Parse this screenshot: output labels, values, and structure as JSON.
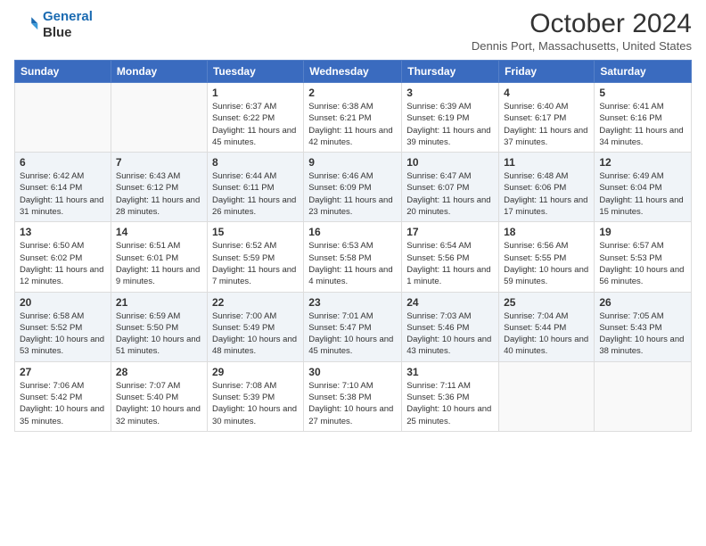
{
  "header": {
    "logo_line1": "General",
    "logo_line2": "Blue",
    "month": "October 2024",
    "location": "Dennis Port, Massachusetts, United States"
  },
  "weekdays": [
    "Sunday",
    "Monday",
    "Tuesday",
    "Wednesday",
    "Thursday",
    "Friday",
    "Saturday"
  ],
  "weeks": [
    [
      {
        "day": "",
        "sunrise": "",
        "sunset": "",
        "daylight": ""
      },
      {
        "day": "",
        "sunrise": "",
        "sunset": "",
        "daylight": ""
      },
      {
        "day": "1",
        "sunrise": "Sunrise: 6:37 AM",
        "sunset": "Sunset: 6:22 PM",
        "daylight": "Daylight: 11 hours and 45 minutes."
      },
      {
        "day": "2",
        "sunrise": "Sunrise: 6:38 AM",
        "sunset": "Sunset: 6:21 PM",
        "daylight": "Daylight: 11 hours and 42 minutes."
      },
      {
        "day": "3",
        "sunrise": "Sunrise: 6:39 AM",
        "sunset": "Sunset: 6:19 PM",
        "daylight": "Daylight: 11 hours and 39 minutes."
      },
      {
        "day": "4",
        "sunrise": "Sunrise: 6:40 AM",
        "sunset": "Sunset: 6:17 PM",
        "daylight": "Daylight: 11 hours and 37 minutes."
      },
      {
        "day": "5",
        "sunrise": "Sunrise: 6:41 AM",
        "sunset": "Sunset: 6:16 PM",
        "daylight": "Daylight: 11 hours and 34 minutes."
      }
    ],
    [
      {
        "day": "6",
        "sunrise": "Sunrise: 6:42 AM",
        "sunset": "Sunset: 6:14 PM",
        "daylight": "Daylight: 11 hours and 31 minutes."
      },
      {
        "day": "7",
        "sunrise": "Sunrise: 6:43 AM",
        "sunset": "Sunset: 6:12 PM",
        "daylight": "Daylight: 11 hours and 28 minutes."
      },
      {
        "day": "8",
        "sunrise": "Sunrise: 6:44 AM",
        "sunset": "Sunset: 6:11 PM",
        "daylight": "Daylight: 11 hours and 26 minutes."
      },
      {
        "day": "9",
        "sunrise": "Sunrise: 6:46 AM",
        "sunset": "Sunset: 6:09 PM",
        "daylight": "Daylight: 11 hours and 23 minutes."
      },
      {
        "day": "10",
        "sunrise": "Sunrise: 6:47 AM",
        "sunset": "Sunset: 6:07 PM",
        "daylight": "Daylight: 11 hours and 20 minutes."
      },
      {
        "day": "11",
        "sunrise": "Sunrise: 6:48 AM",
        "sunset": "Sunset: 6:06 PM",
        "daylight": "Daylight: 11 hours and 17 minutes."
      },
      {
        "day": "12",
        "sunrise": "Sunrise: 6:49 AM",
        "sunset": "Sunset: 6:04 PM",
        "daylight": "Daylight: 11 hours and 15 minutes."
      }
    ],
    [
      {
        "day": "13",
        "sunrise": "Sunrise: 6:50 AM",
        "sunset": "Sunset: 6:02 PM",
        "daylight": "Daylight: 11 hours and 12 minutes."
      },
      {
        "day": "14",
        "sunrise": "Sunrise: 6:51 AM",
        "sunset": "Sunset: 6:01 PM",
        "daylight": "Daylight: 11 hours and 9 minutes."
      },
      {
        "day": "15",
        "sunrise": "Sunrise: 6:52 AM",
        "sunset": "Sunset: 5:59 PM",
        "daylight": "Daylight: 11 hours and 7 minutes."
      },
      {
        "day": "16",
        "sunrise": "Sunrise: 6:53 AM",
        "sunset": "Sunset: 5:58 PM",
        "daylight": "Daylight: 11 hours and 4 minutes."
      },
      {
        "day": "17",
        "sunrise": "Sunrise: 6:54 AM",
        "sunset": "Sunset: 5:56 PM",
        "daylight": "Daylight: 11 hours and 1 minute."
      },
      {
        "day": "18",
        "sunrise": "Sunrise: 6:56 AM",
        "sunset": "Sunset: 5:55 PM",
        "daylight": "Daylight: 10 hours and 59 minutes."
      },
      {
        "day": "19",
        "sunrise": "Sunrise: 6:57 AM",
        "sunset": "Sunset: 5:53 PM",
        "daylight": "Daylight: 10 hours and 56 minutes."
      }
    ],
    [
      {
        "day": "20",
        "sunrise": "Sunrise: 6:58 AM",
        "sunset": "Sunset: 5:52 PM",
        "daylight": "Daylight: 10 hours and 53 minutes."
      },
      {
        "day": "21",
        "sunrise": "Sunrise: 6:59 AM",
        "sunset": "Sunset: 5:50 PM",
        "daylight": "Daylight: 10 hours and 51 minutes."
      },
      {
        "day": "22",
        "sunrise": "Sunrise: 7:00 AM",
        "sunset": "Sunset: 5:49 PM",
        "daylight": "Daylight: 10 hours and 48 minutes."
      },
      {
        "day": "23",
        "sunrise": "Sunrise: 7:01 AM",
        "sunset": "Sunset: 5:47 PM",
        "daylight": "Daylight: 10 hours and 45 minutes."
      },
      {
        "day": "24",
        "sunrise": "Sunrise: 7:03 AM",
        "sunset": "Sunset: 5:46 PM",
        "daylight": "Daylight: 10 hours and 43 minutes."
      },
      {
        "day": "25",
        "sunrise": "Sunrise: 7:04 AM",
        "sunset": "Sunset: 5:44 PM",
        "daylight": "Daylight: 10 hours and 40 minutes."
      },
      {
        "day": "26",
        "sunrise": "Sunrise: 7:05 AM",
        "sunset": "Sunset: 5:43 PM",
        "daylight": "Daylight: 10 hours and 38 minutes."
      }
    ],
    [
      {
        "day": "27",
        "sunrise": "Sunrise: 7:06 AM",
        "sunset": "Sunset: 5:42 PM",
        "daylight": "Daylight: 10 hours and 35 minutes."
      },
      {
        "day": "28",
        "sunrise": "Sunrise: 7:07 AM",
        "sunset": "Sunset: 5:40 PM",
        "daylight": "Daylight: 10 hours and 32 minutes."
      },
      {
        "day": "29",
        "sunrise": "Sunrise: 7:08 AM",
        "sunset": "Sunset: 5:39 PM",
        "daylight": "Daylight: 10 hours and 30 minutes."
      },
      {
        "day": "30",
        "sunrise": "Sunrise: 7:10 AM",
        "sunset": "Sunset: 5:38 PM",
        "daylight": "Daylight: 10 hours and 27 minutes."
      },
      {
        "day": "31",
        "sunrise": "Sunrise: 7:11 AM",
        "sunset": "Sunset: 5:36 PM",
        "daylight": "Daylight: 10 hours and 25 minutes."
      },
      {
        "day": "",
        "sunrise": "",
        "sunset": "",
        "daylight": ""
      },
      {
        "day": "",
        "sunrise": "",
        "sunset": "",
        "daylight": ""
      }
    ]
  ]
}
